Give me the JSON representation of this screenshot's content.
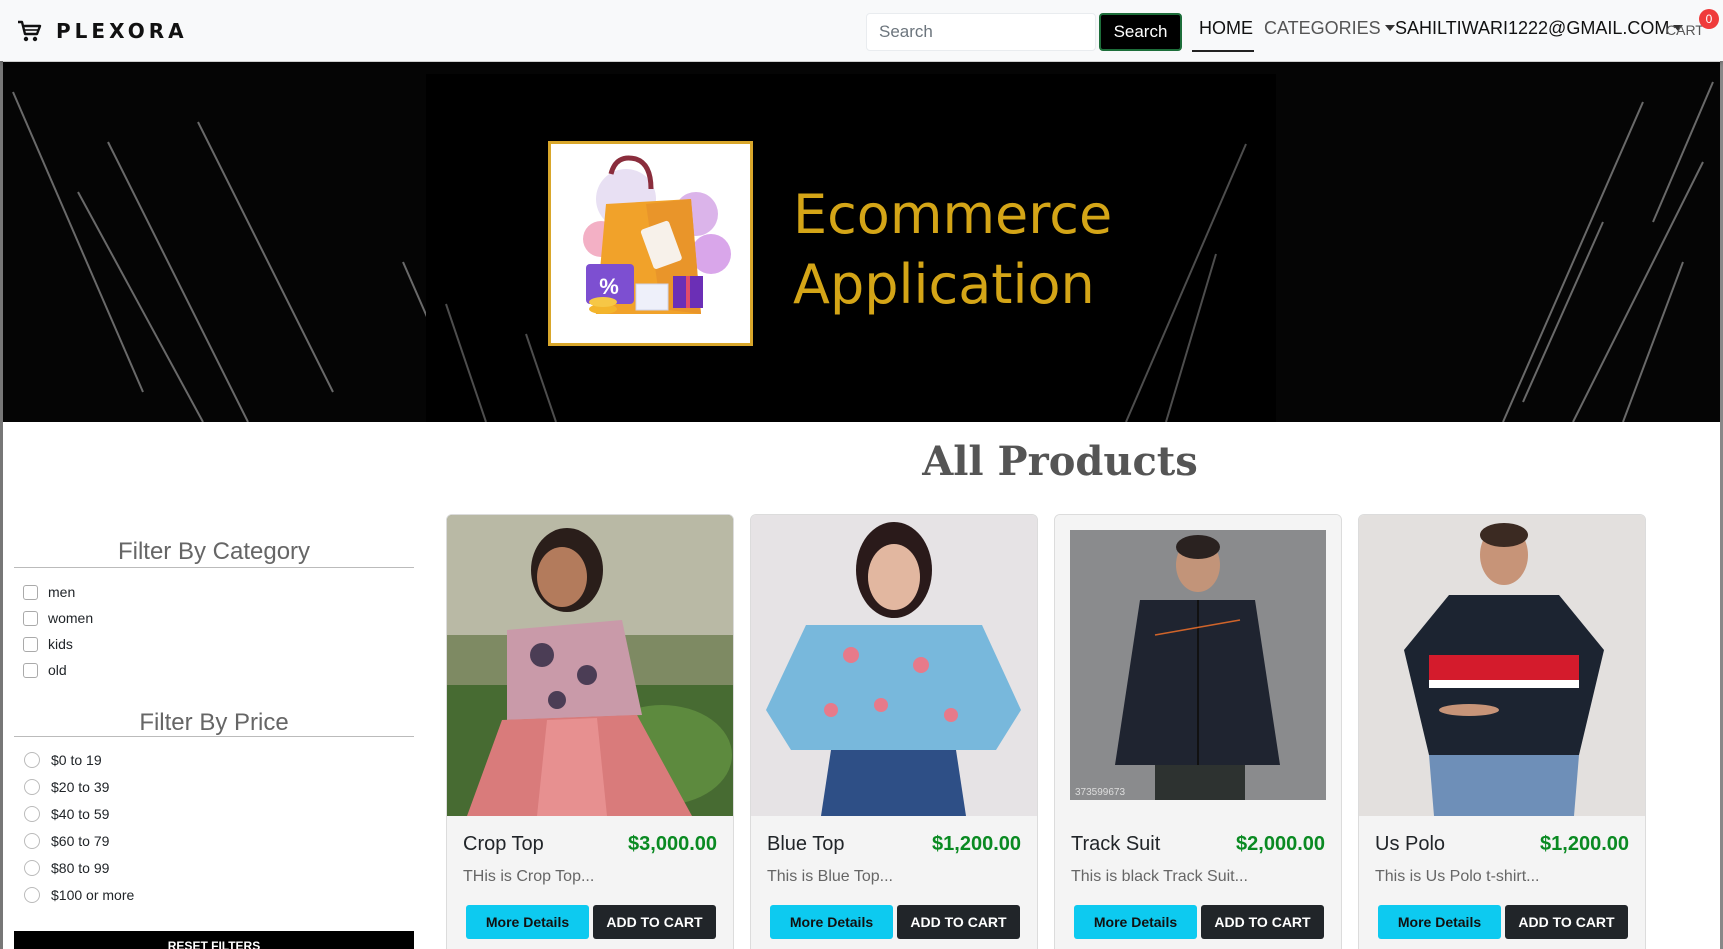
{
  "navbar": {
    "brand": "PLEXORA",
    "search_placeholder": "Search",
    "search_button": "Search",
    "home": "HOME",
    "categories": "CATEGORIES",
    "user": "SAHILTIWARI1222@GMAIL.COM",
    "cart": "CART",
    "cart_count": "0"
  },
  "banner": {
    "title": "Ecommerce\nApplication"
  },
  "main": {
    "title": "All Products"
  },
  "filters": {
    "category_heading": "Filter By Category",
    "categories": [
      "men",
      "women",
      "kids",
      "old"
    ],
    "price_heading": "Filter By Price",
    "prices": [
      "$0 to 19",
      "$20 to 39",
      "$40 to 59",
      "$60 to 79",
      "$80 to 99",
      "$100 or more"
    ],
    "reset": "RESET FILTERS"
  },
  "products": [
    {
      "name": "Crop Top",
      "price": "$3,000.00",
      "description": "THis is Crop Top...",
      "details": "More Details",
      "add": "ADD TO CART"
    },
    {
      "name": "Blue Top",
      "price": "$1,200.00",
      "description": "This is Blue Top...",
      "details": "More Details",
      "add": "ADD TO CART"
    },
    {
      "name": "Track Suit",
      "price": "$2,000.00",
      "description": "This is black Track Suit...",
      "details": "More Details",
      "add": "ADD TO CART",
      "watermark": "373599673"
    },
    {
      "name": "Us Polo",
      "price": "$1,200.00",
      "description": "This is Us Polo t-shirt...",
      "details": "More Details",
      "add": "ADD TO CART"
    }
  ],
  "colors": {
    "accent_cyan": "#0dcaf0",
    "price_green": "#0a8a22",
    "banner_gold": "#d4a517",
    "badge_red": "#ef3b3b"
  }
}
